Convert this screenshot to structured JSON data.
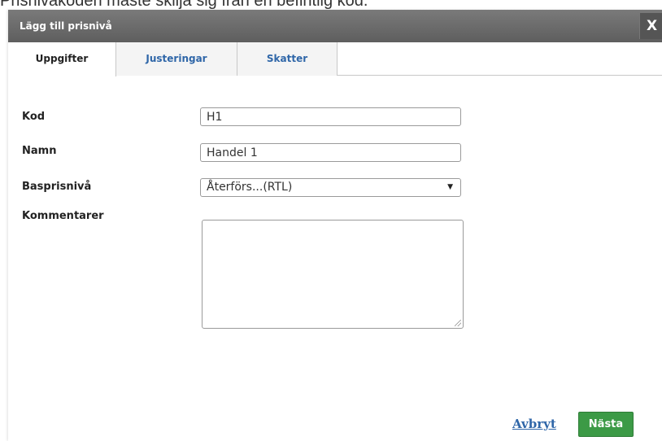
{
  "background": {
    "message": "Prisnivåkoden måste skilja sig från en befintlig kod."
  },
  "dialog": {
    "title": "Lägg till prisnivå",
    "close_label": "X",
    "tabs": [
      {
        "label": "Uppgifter",
        "active": true
      },
      {
        "label": "Justeringar",
        "active": false
      },
      {
        "label": "Skatter",
        "active": false
      }
    ],
    "form": {
      "code": {
        "label": "Kod",
        "value": "H1"
      },
      "name": {
        "label": "Namn",
        "value": "Handel 1"
      },
      "base_price_level": {
        "label": "Basprisnivå",
        "value": "Återförs...(RTL)",
        "arrow": "▼"
      },
      "comments": {
        "label": "Kommentarer",
        "value": ""
      }
    },
    "footer": {
      "cancel_label": "Avbryt",
      "next_label": "Nästa"
    }
  },
  "colors": {
    "titlebar": "#666666",
    "link": "#2f66a8",
    "primary_button": "#3c9a46"
  }
}
